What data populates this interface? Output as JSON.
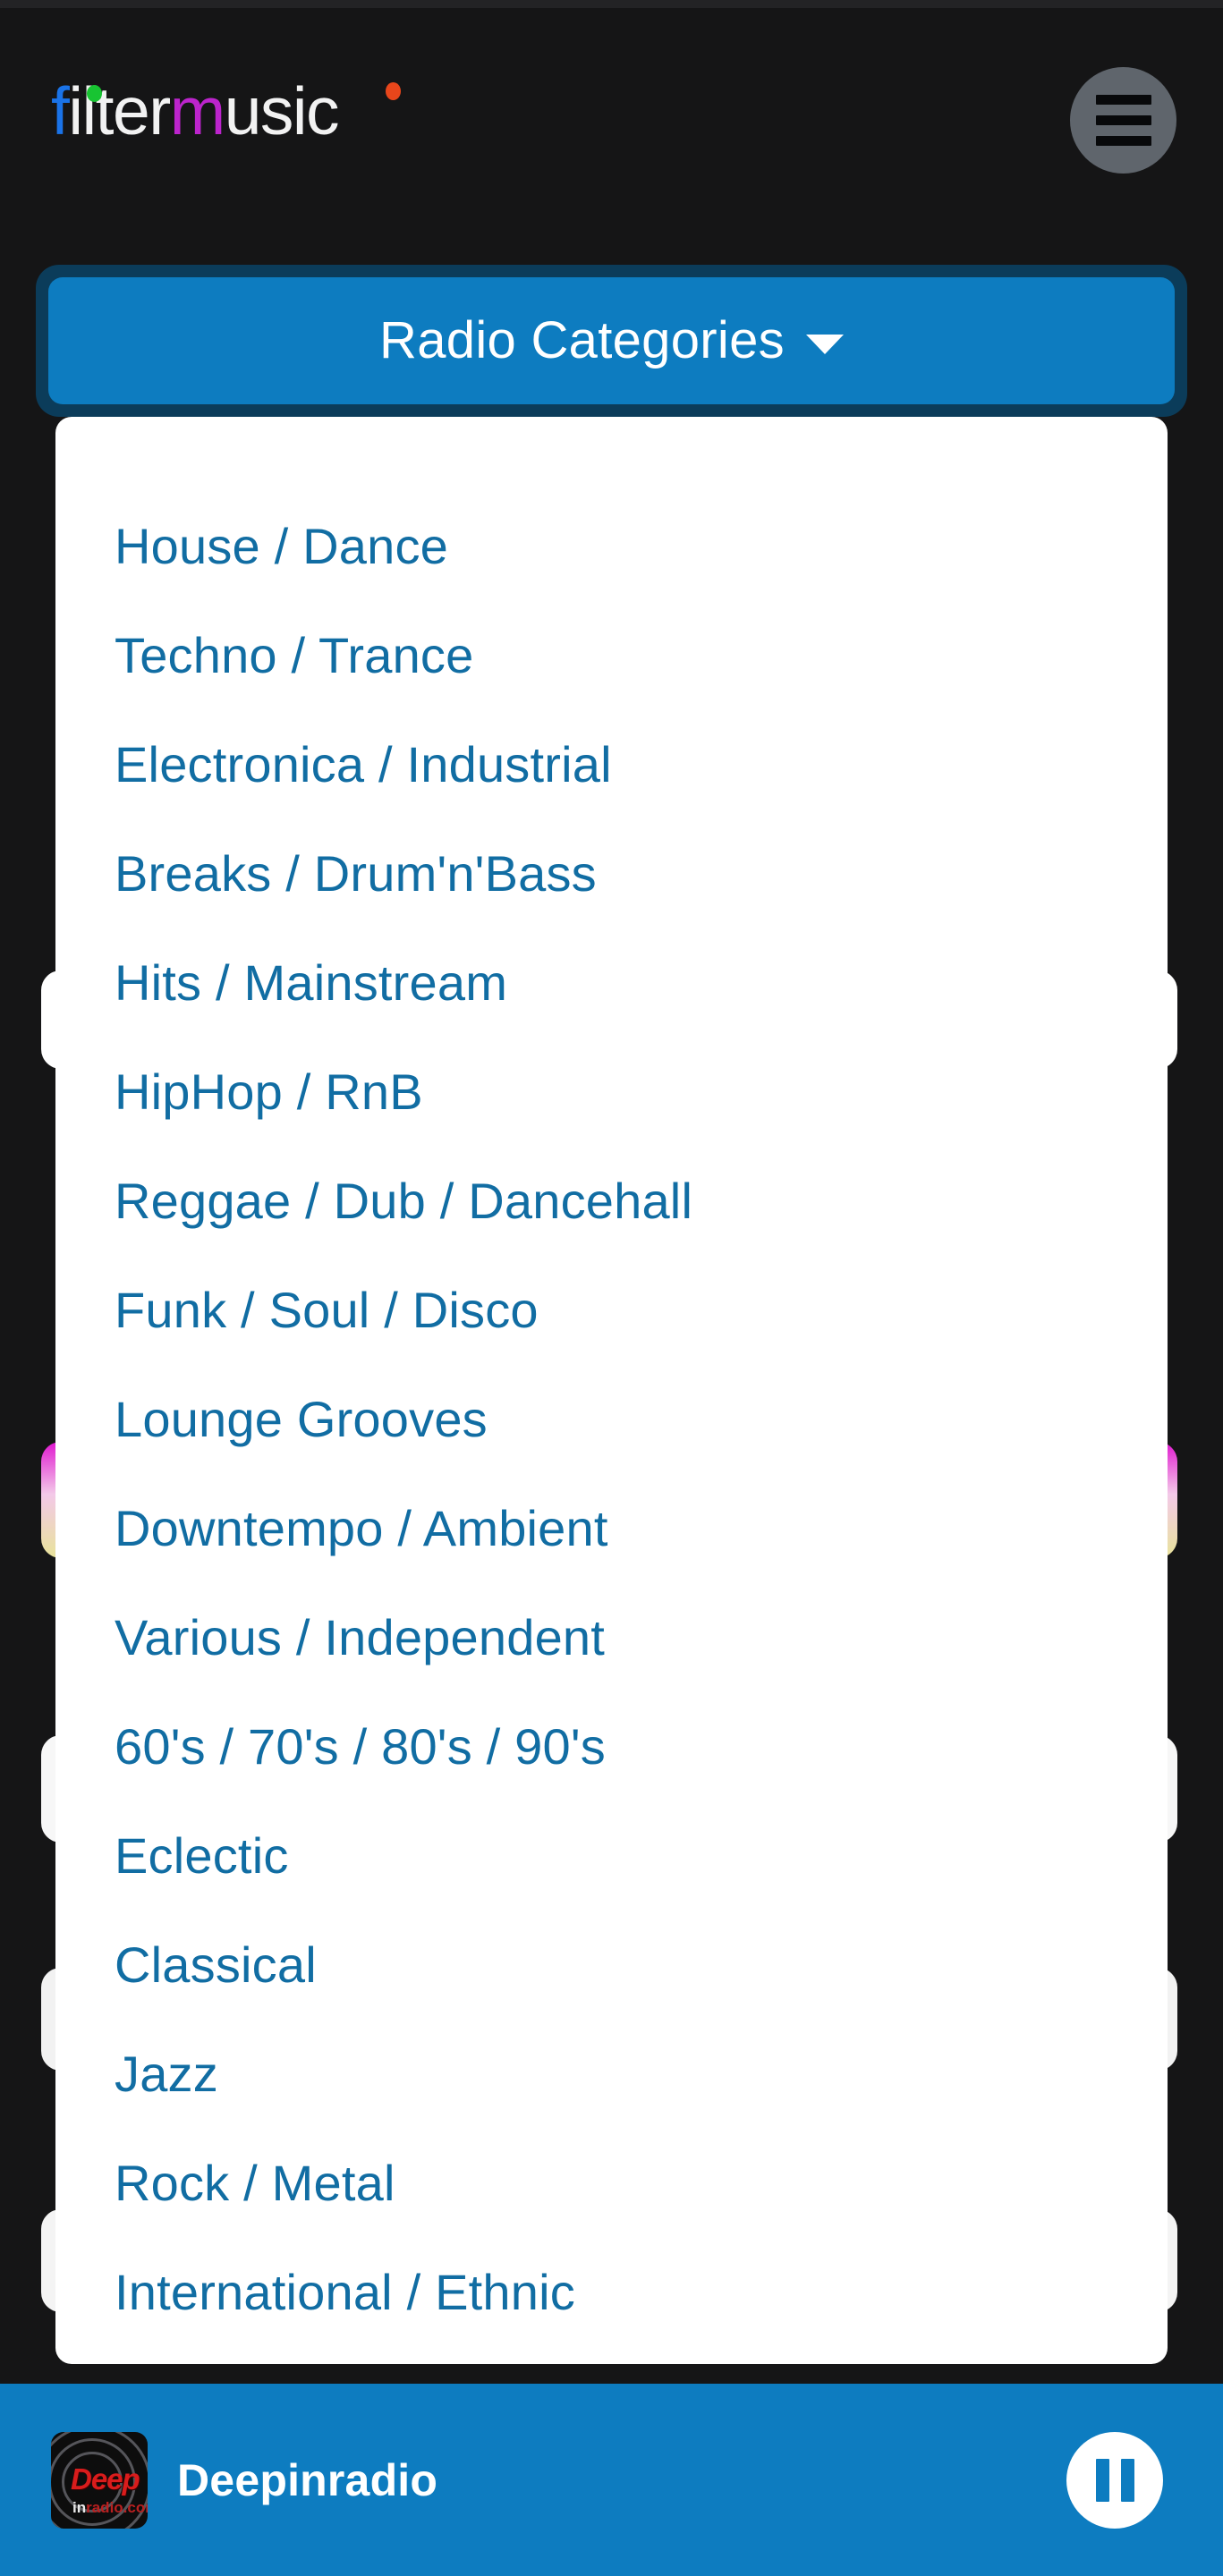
{
  "app": {
    "brand": {
      "part_f": "f",
      "part_ilter": "ilter",
      "part_m": "m",
      "part_usic": "usic",
      "full_name": "filtermusic",
      "color_f": "#1a73e8",
      "color_m": "#bc24cc",
      "color_text": "#f2f2f2",
      "dot_green": "#18c432",
      "dot_orange": "#e8461b"
    },
    "background": "#151516",
    "accent": "#0d7cc0"
  },
  "header": {
    "menu_button_label": "Menu"
  },
  "dropdown": {
    "label": "Radio Categories",
    "expanded": true,
    "caret": "chevron-down",
    "button_fill": "#0d7cc0",
    "button_border": "#0b3c5a",
    "item_color": "#116da3",
    "items": [
      {
        "label": "House / Dance"
      },
      {
        "label": "Techno / Trance"
      },
      {
        "label": "Electronica / Industrial"
      },
      {
        "label": "Breaks / Drum'n'Bass"
      },
      {
        "label": "Hits / Mainstream"
      },
      {
        "label": "HipHop / RnB"
      },
      {
        "label": "Reggae / Dub / Dancehall"
      },
      {
        "label": "Funk / Soul / Disco"
      },
      {
        "label": "Lounge Grooves"
      },
      {
        "label": "Downtempo / Ambient"
      },
      {
        "label": "Various / Independent"
      },
      {
        "label": "60's / 70's / 80's / 90's"
      },
      {
        "label": "Eclectic"
      },
      {
        "label": "Classical"
      },
      {
        "label": "Jazz"
      },
      {
        "label": "Rock / Metal"
      },
      {
        "label": "International / Ethnic"
      }
    ]
  },
  "player": {
    "station_name": "Deepinradio",
    "state": "playing",
    "transport_icon": "pause-icon",
    "bar_color": "#0d7cc0",
    "artwork": {
      "wordmark": "Deep",
      "sub_prefix": "in",
      "sub_suffix": "radio.com",
      "wordmark_color": "#d91c1c"
    }
  }
}
